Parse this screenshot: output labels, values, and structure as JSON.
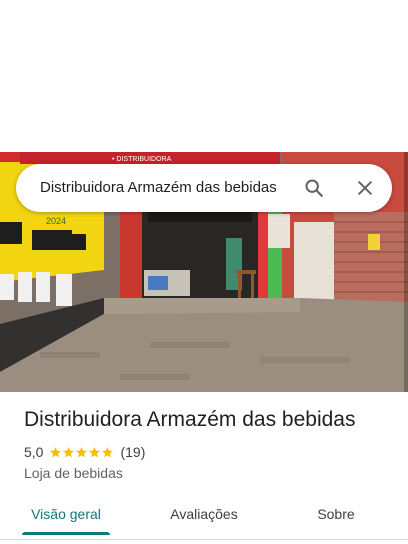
{
  "search": {
    "query": "Distribuidora Armazém das bebidas"
  },
  "photo": {
    "banner_text": "• DISTRIBUIDORA",
    "wall_text": "2024"
  },
  "place": {
    "name": "Distribuidora Armazém das bebidas",
    "rating": "5,0",
    "stars": 5,
    "reviews": "(19)",
    "category": "Loja de bebidas"
  },
  "tabs": [
    {
      "label": "Visão geral",
      "active": true
    },
    {
      "label": "Avaliações",
      "active": false
    },
    {
      "label": "Sobre",
      "active": false
    }
  ],
  "colors": {
    "accent": "#0b7b78",
    "star": "#fbbc04"
  },
  "icons": [
    "search-icon",
    "close-icon",
    "star-icon"
  ]
}
